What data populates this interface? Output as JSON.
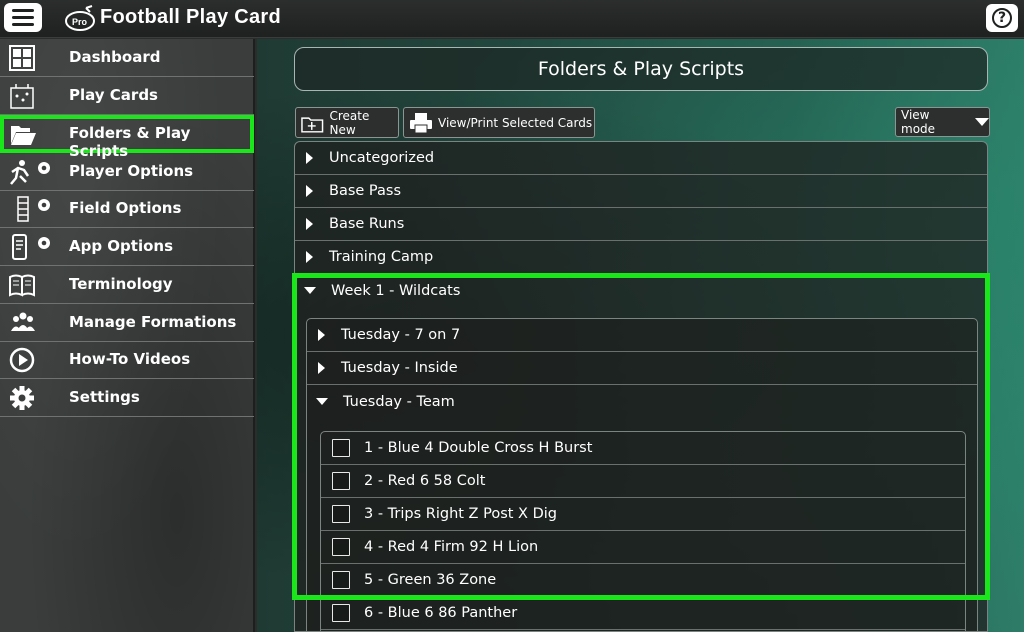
{
  "app": {
    "title": "Football Play Card",
    "logo_text": "Pro",
    "menu_icon": "hamburger-menu-icon",
    "help_icon": "help-question-icon",
    "help_glyph": "?"
  },
  "sidebar": {
    "items": [
      {
        "label": "Dashboard",
        "icon": "grid-dashboard-icon"
      },
      {
        "label": "Play Cards",
        "icon": "play-card-diagram-icon"
      },
      {
        "label": "Folders & Play Scripts",
        "icon": "open-folder-icon",
        "active": true
      },
      {
        "label": "Player Options",
        "icon": "running-player-gear-icon"
      },
      {
        "label": "Field Options",
        "icon": "field-gear-icon"
      },
      {
        "label": "App Options",
        "icon": "phone-gear-icon"
      },
      {
        "label": "Terminology",
        "icon": "open-book-icon"
      },
      {
        "label": "Manage Formations",
        "icon": "group-people-icon"
      },
      {
        "label": "How-To Videos",
        "icon": "play-circle-icon"
      },
      {
        "label": "Settings",
        "icon": "gear-icon"
      }
    ]
  },
  "main": {
    "header_title": "Folders & Play Scripts",
    "toolbar": {
      "create_label": "Create New",
      "print_label": "View/Print Selected Cards",
      "view_mode_label": "View mode"
    },
    "folders": [
      {
        "label": "Uncategorized",
        "expanded": false
      },
      {
        "label": "Base Pass",
        "expanded": false
      },
      {
        "label": "Base Runs",
        "expanded": false
      },
      {
        "label": "Training Camp",
        "expanded": false
      },
      {
        "label": "Week 1 - Wildcats",
        "expanded": true
      }
    ],
    "subfolders": [
      {
        "label": "Tuesday - 7 on 7",
        "expanded": false
      },
      {
        "label": "Tuesday - Inside",
        "expanded": false
      },
      {
        "label": "Tuesday - Team",
        "expanded": true
      }
    ],
    "plays": [
      {
        "label": "1 - Blue 4 Double Cross H Burst",
        "checked": false
      },
      {
        "label": "2 - Red 6 58 Colt",
        "checked": false
      },
      {
        "label": "3 - Trips Right Z Post X Dig",
        "checked": false
      },
      {
        "label": "4 - Red 4 Firm 92 H Lion",
        "checked": false
      },
      {
        "label": "5 - Green 36 Zone",
        "checked": false
      },
      {
        "label": "6 - Blue 6 86 Panther",
        "checked": false
      }
    ]
  },
  "colors": {
    "highlight": "#1be61b",
    "accent_bg": "#2f7a68"
  }
}
